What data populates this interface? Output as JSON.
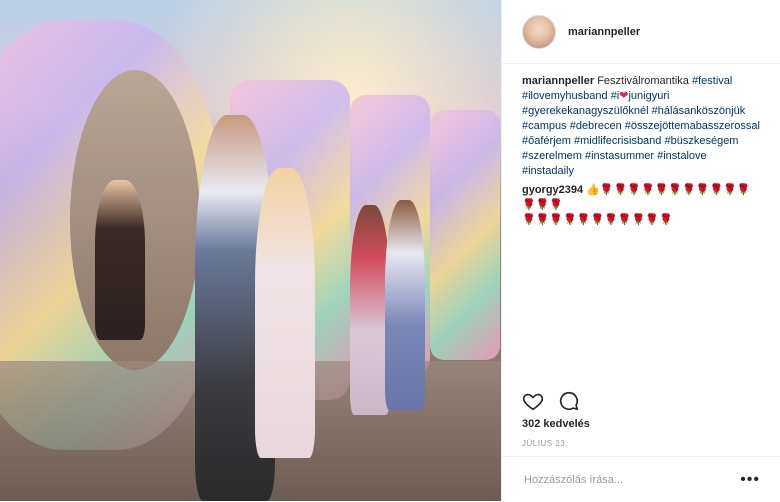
{
  "post": {
    "username": "mariannpeller",
    "caption_user": "mariannpeller",
    "caption_text_1": "Fesztiválromantika",
    "caption_tag_festival": "#festival",
    "caption_tag_ilovemyhusband": "#ilovemyhusband",
    "caption_tag_i": "#i",
    "caption_emoji_heart": "❤",
    "caption_tag_junigyuri": "junigyuri",
    "caption_tag_gyerekek": "#gyerekekanagyszülőknél",
    "caption_tag_halasan": "#hálásanköszönjük",
    "caption_tag_campus": "#campus",
    "caption_tag_debrecen": "#debrecen",
    "caption_tag_osszejott": "#összejöttemabasszerossal",
    "caption_tag_oaferjem": "#őaférjem",
    "caption_tag_midlife": "#midlifecrisisband",
    "caption_tag_buszke": "#büszkeségem",
    "caption_tag_szerelmem": "#szerelmem",
    "caption_tag_instasummer": "#instasummer",
    "caption_tag_instalove": "#instalove",
    "caption_tag_instadaily": "#instadaily",
    "comment_user": "gyorgy2394",
    "comment_emoji_line1": "👍🌹🌹🌹🌹🌹🌹🌹🌹🌹🌹🌹🌹🌹🌹",
    "comment_emoji_line2": "🌹🌹🌹🌹🌹🌹🌹🌹🌹🌹🌹",
    "likes": "302 kedvelés",
    "date": "JÚLIUS 23.",
    "comment_placeholder": "Hozzászólás írása...",
    "more_label": "•••"
  },
  "icons": {
    "like": "heart-icon",
    "comment": "comment-bubble-icon",
    "more": "more-options-icon"
  },
  "colors": {
    "hashtag": "#003569",
    "heart_emoji": "#e0245e"
  }
}
